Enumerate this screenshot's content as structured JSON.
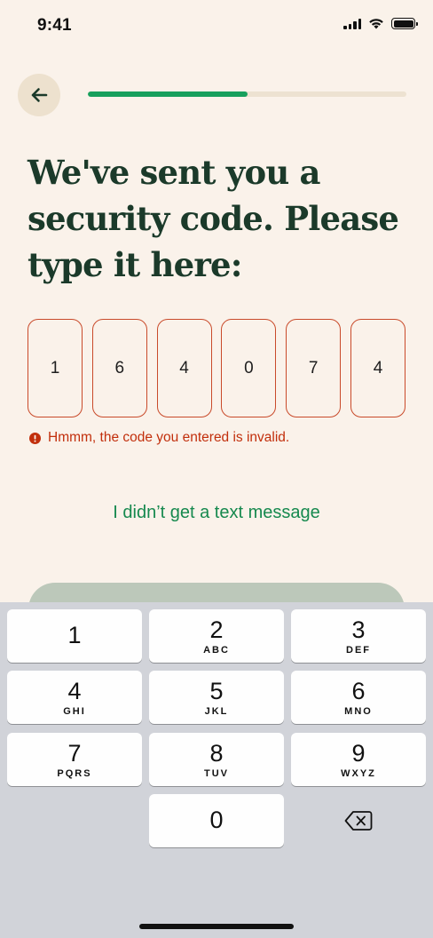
{
  "status_bar": {
    "time": "9:41"
  },
  "header": {
    "progress_fraction": 0.5
  },
  "headline": "We've sent you a security code. Please type it here:",
  "code": {
    "digits": [
      "1",
      "6",
      "4",
      "0",
      "7",
      "4"
    ],
    "error_message": "Hmmm, the code you entered is invalid."
  },
  "resend_link": "I didn’t get a text message",
  "keyboard": {
    "keys": [
      {
        "num": "1",
        "letters": ""
      },
      {
        "num": "2",
        "letters": "ABC"
      },
      {
        "num": "3",
        "letters": "DEF"
      },
      {
        "num": "4",
        "letters": "GHI"
      },
      {
        "num": "5",
        "letters": "JKL"
      },
      {
        "num": "6",
        "letters": "MNO"
      },
      {
        "num": "7",
        "letters": "PQRS"
      },
      {
        "num": "8",
        "letters": "TUV"
      },
      {
        "num": "9",
        "letters": "WXYZ"
      },
      {
        "num": "0",
        "letters": ""
      }
    ]
  },
  "colors": {
    "background": "#FAF2EA",
    "accent_green": "#17A05D",
    "error_red": "#C22F0C",
    "headline": "#1B3A2A"
  },
  "icons": [
    "arrow-left-icon",
    "cellular-signal-icon",
    "wifi-icon",
    "battery-icon",
    "error-circle-icon",
    "backspace-icon"
  ]
}
